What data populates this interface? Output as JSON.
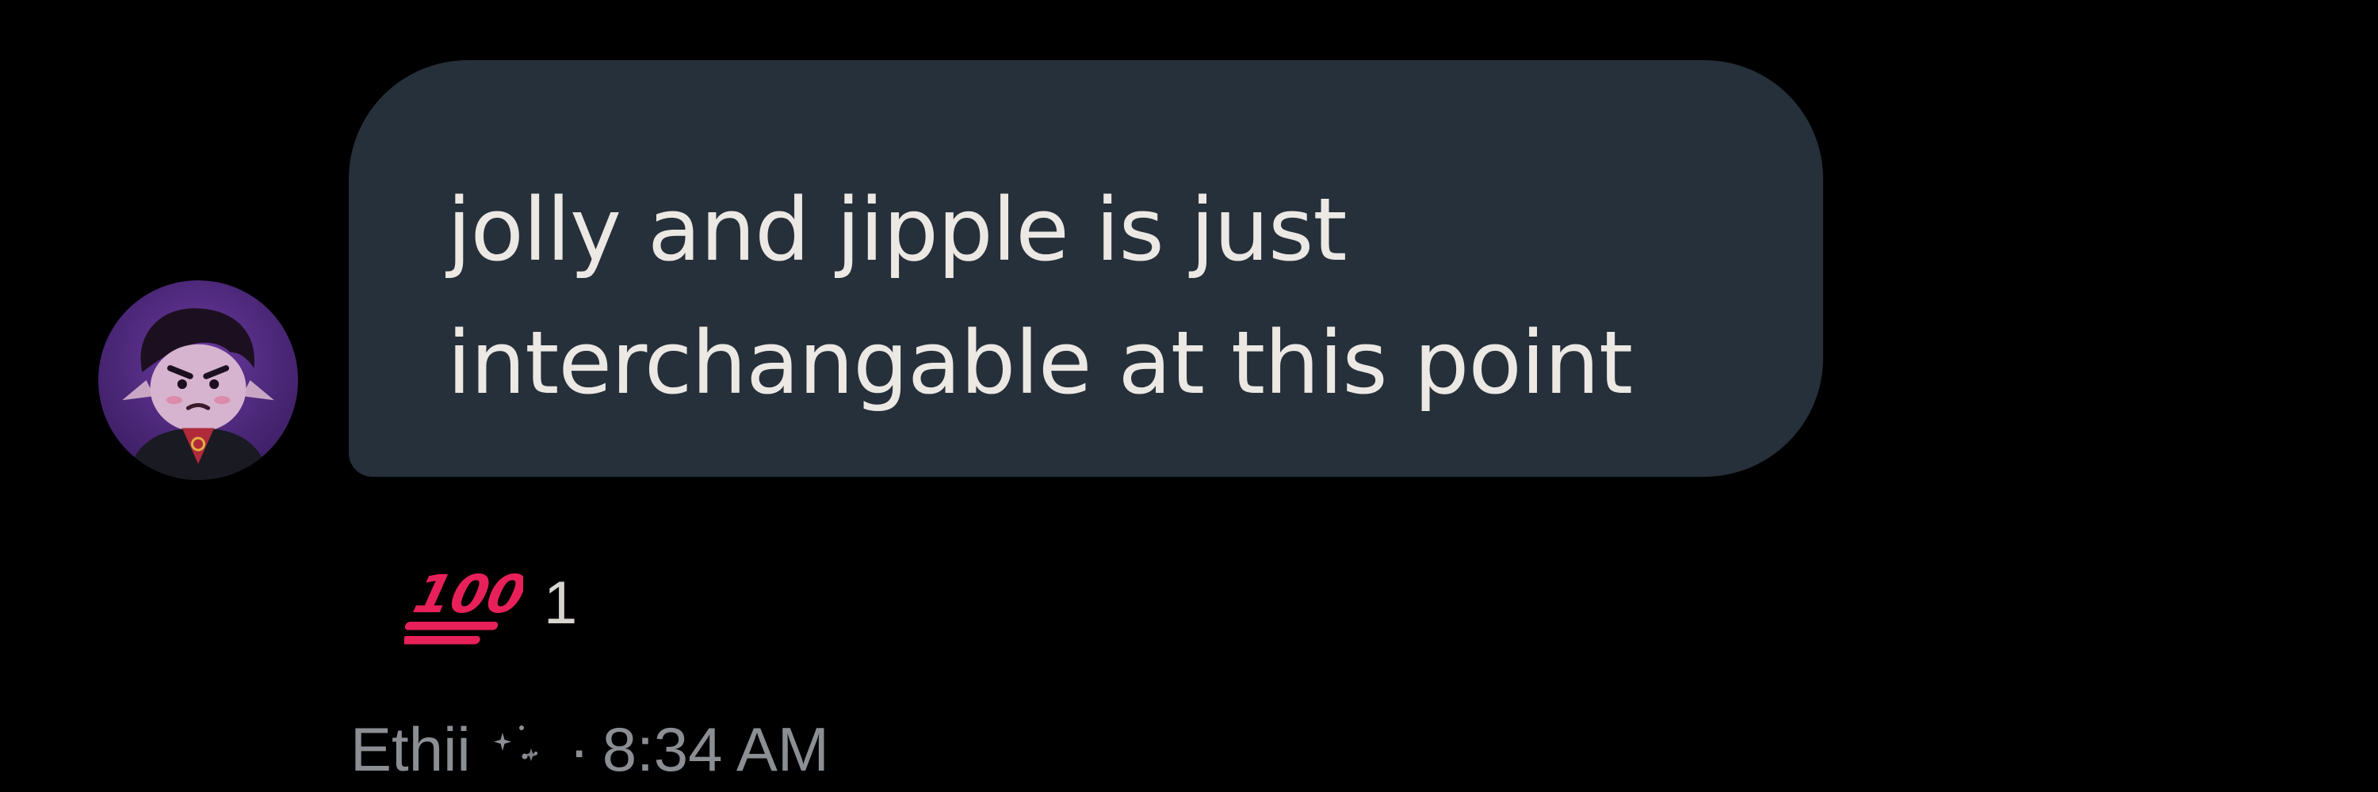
{
  "message": {
    "text": "jolly and jipple is just\ninterchangable at this point",
    "bubble_color": "#26303a",
    "text_color": "#ece8e4"
  },
  "reaction": {
    "emoji": "100-emoji",
    "count": "1",
    "accent_color": "#e8205a"
  },
  "meta": {
    "sender": "Ethii",
    "sender_decoration": "sparkles-icon",
    "separator": "·",
    "timestamp": "8:34 AM"
  },
  "avatar": {
    "icon": "user-avatar",
    "bg_color": "#5b2f8c"
  }
}
